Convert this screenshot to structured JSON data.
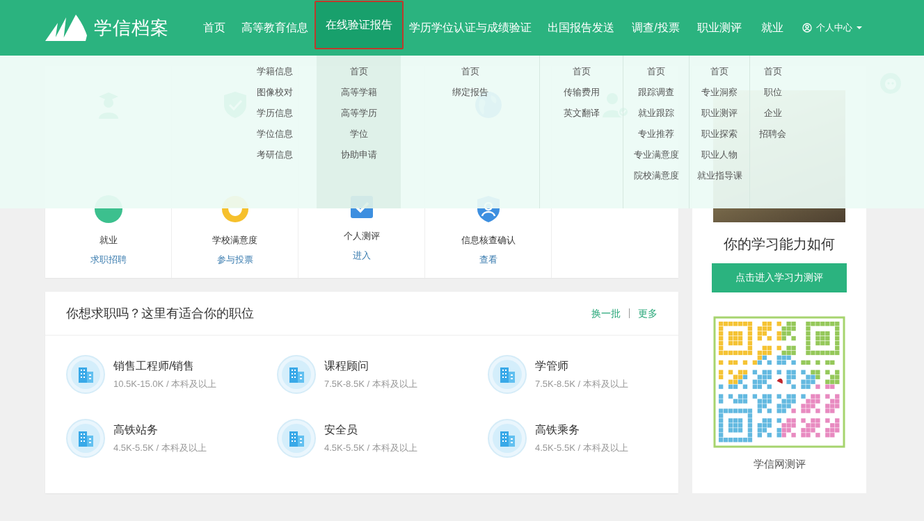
{
  "header": {
    "logo_text": "学信档案",
    "nav": [
      {
        "label": "首页",
        "selected": false
      },
      {
        "label": "高等教育信息",
        "selected": false,
        "submenu": [
          "学籍信息",
          "图像校对",
          "学历信息",
          "学位信息",
          "考研信息"
        ]
      },
      {
        "label": "在线验证报告",
        "selected": true,
        "submenu": [
          "首页",
          "高等学籍",
          "高等学历",
          "学位",
          "协助申请"
        ]
      },
      {
        "label": "学历学位认证与成绩验证",
        "selected": false,
        "submenu": [
          "首页",
          "绑定报告"
        ]
      },
      {
        "label": "出国报告发送",
        "selected": false,
        "submenu": [
          "首页",
          "传输费用",
          "英文翻译"
        ]
      },
      {
        "label": "调查/投票",
        "selected": false,
        "submenu": [
          "首页",
          "跟踪调查",
          "就业跟踪",
          "专业推荐",
          "专业满意度",
          "院校满意度"
        ]
      },
      {
        "label": "职业测评",
        "selected": false,
        "submenu": [
          "首页",
          "专业洞察",
          "职业测评",
          "职业探索",
          "职业人物",
          "就业指导课"
        ]
      },
      {
        "label": "就业",
        "selected": false,
        "submenu": [
          "首页",
          "职位",
          "企业",
          "招聘会"
        ]
      }
    ],
    "user_menu": {
      "label": "个人中心"
    }
  },
  "services": [
    {
      "kind": "graduate"
    },
    {
      "kind": "shield"
    },
    {
      "kind": "covered"
    },
    {
      "kind": "globe"
    },
    {
      "kind": "person"
    },
    {
      "kind": "offer",
      "title": "就业",
      "links": [
        "求职招聘"
      ]
    },
    {
      "kind": "smiley",
      "title": "学校满意度",
      "links": [
        "参与投票"
      ]
    },
    {
      "kind": "checkbox",
      "title": "个人测评",
      "links": [
        "进入"
      ]
    },
    {
      "kind": "shield-person",
      "title": "信息核查确认",
      "links": [
        "查看"
      ]
    }
  ],
  "jobs": {
    "title": "你想求职吗？这里有适合你的职位",
    "actions": [
      "换一批",
      "更多"
    ],
    "items": [
      {
        "title": "销售工程师/销售",
        "detail": "10.5K-15.0K / 本科及以上"
      },
      {
        "title": "课程顾问",
        "detail": "7.5K-8.5K / 本科及以上"
      },
      {
        "title": "学管师",
        "detail": "7.5K-8.5K / 本科及以上"
      },
      {
        "title": "高铁站务",
        "detail": "4.5K-5.5K / 本科及以上"
      },
      {
        "title": "安全员",
        "detail": "4.5K-5.5K / 本科及以上"
      },
      {
        "title": "高铁乘务",
        "detail": "4.5K-5.5K / 本科及以上"
      }
    ]
  },
  "side": {
    "title": "你的学习能力如何",
    "button": "点击进入学习力测评",
    "qr_caption": "学信网测评"
  }
}
